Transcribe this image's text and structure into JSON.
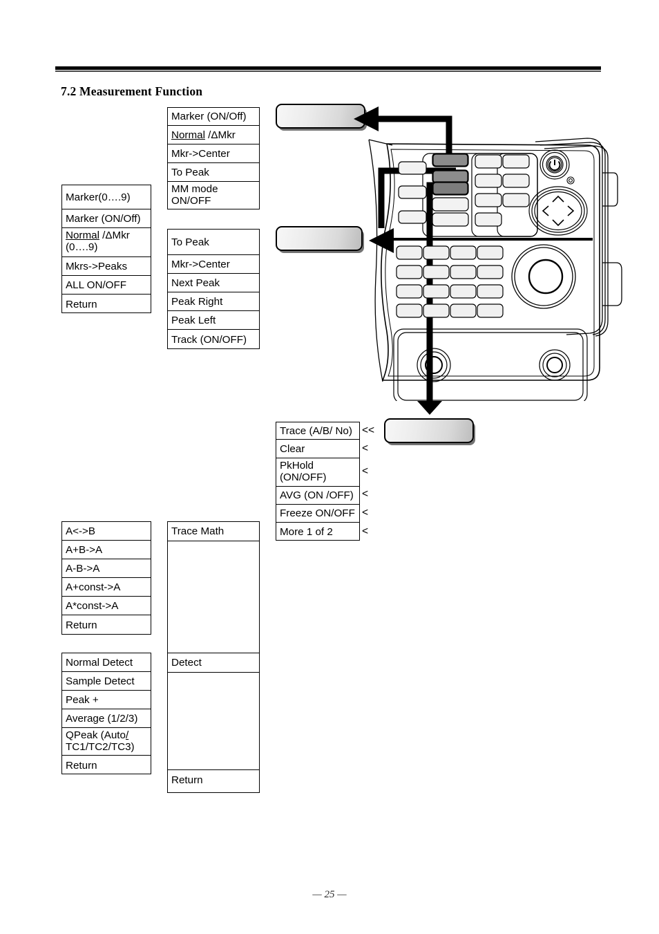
{
  "document": {
    "section_heading": "7.2 Measurement Function",
    "page_number": "— 25 —"
  },
  "menus": {
    "marker_menu": {
      "name": "Marker menu",
      "rows": [
        {
          "text": "Marker (ON/Off)"
        },
        {
          "text": "Normal /ΔMkr",
          "underline": "Normal"
        },
        {
          "text": "Mkr->Center"
        },
        {
          "text": "To Peak"
        },
        {
          "text": "MM mode\nON/OFF",
          "two_line": true
        }
      ]
    },
    "marker_sub_menu": {
      "name": "Marker number menu",
      "rows": [
        {
          "text": "Marker(0….9)"
        },
        {
          "text": "Marker (ON/Off)"
        },
        {
          "text": "Normal /ΔMkr\n(0….9)",
          "underline": "Normal",
          "two_line": true
        },
        {
          "text": "Mkrs->Peaks"
        },
        {
          "text": "ALL ON/OFF"
        },
        {
          "text": "Return"
        }
      ]
    },
    "peak_menu": {
      "name": "To Peak menu",
      "rows": [
        {
          "text": "To Peak"
        },
        {
          "text": "Mkr->Center"
        },
        {
          "text": "Next Peak"
        },
        {
          "text": "Peak Right"
        },
        {
          "text": "Peak Left"
        },
        {
          "text": "Track (ON/OFF)"
        }
      ]
    },
    "trace_menu": {
      "name": "Trace menu",
      "rows": [
        {
          "text": "Trace (A/B/ No)",
          "marker": "<<"
        },
        {
          "text": "Clear",
          "marker": "<"
        },
        {
          "text": "PkHold\n(ON/OFF)",
          "marker": "<",
          "two_line": true
        },
        {
          "text": "AVG (ON /OFF)",
          "marker": "<"
        },
        {
          "text": "Freeze ON/OFF",
          "marker": "<"
        },
        {
          "text": "More 1 of 2",
          "marker": "<"
        }
      ]
    },
    "trace_math_menu": {
      "name": "Trace Math menu",
      "rows": [
        {
          "text": "A<->B"
        },
        {
          "text": "A+B->A"
        },
        {
          "text": "A-B->A"
        },
        {
          "text": "A+const->A"
        },
        {
          "text": "A*const->A"
        },
        {
          "text": "Return"
        }
      ]
    },
    "detect_menu": {
      "name": "Detect menu",
      "rows": [
        {
          "text": "Normal Detect"
        },
        {
          "text": "Sample Detect"
        },
        {
          "text": "Peak +"
        },
        {
          "text": "Average (1/2/3)"
        },
        {
          "text": "QPeak (Auto/\nTC1/TC2/TC3)",
          "two_line": true
        },
        {
          "text": "Return"
        }
      ]
    },
    "right_column_menu": {
      "name": "Right column menu",
      "rows": [
        {
          "text": "Trace Math"
        },
        {
          "text": ""
        },
        {
          "text": "Detect"
        },
        {
          "text": ""
        },
        {
          "text": "Return"
        }
      ]
    }
  },
  "instrument": {
    "name": "Spectrum analyzer front panel",
    "power_icon": "power-icon",
    "dpad_icons": [
      "chevron-up-icon",
      "chevron-left-icon",
      "chevron-right-icon",
      "chevron-down-icon"
    ],
    "highlighted_keys": 3
  },
  "callout_buttons": [
    {
      "name": "marker-softkey-callout"
    },
    {
      "name": "peak-softkey-callout"
    },
    {
      "name": "trace-softkey-callout"
    }
  ],
  "colors": {
    "ink": "#000000",
    "highlight_key": "#8a8a8a",
    "button_gradient_light": "#f7f7f7",
    "button_gradient_dark": "#bdbdbd"
  }
}
